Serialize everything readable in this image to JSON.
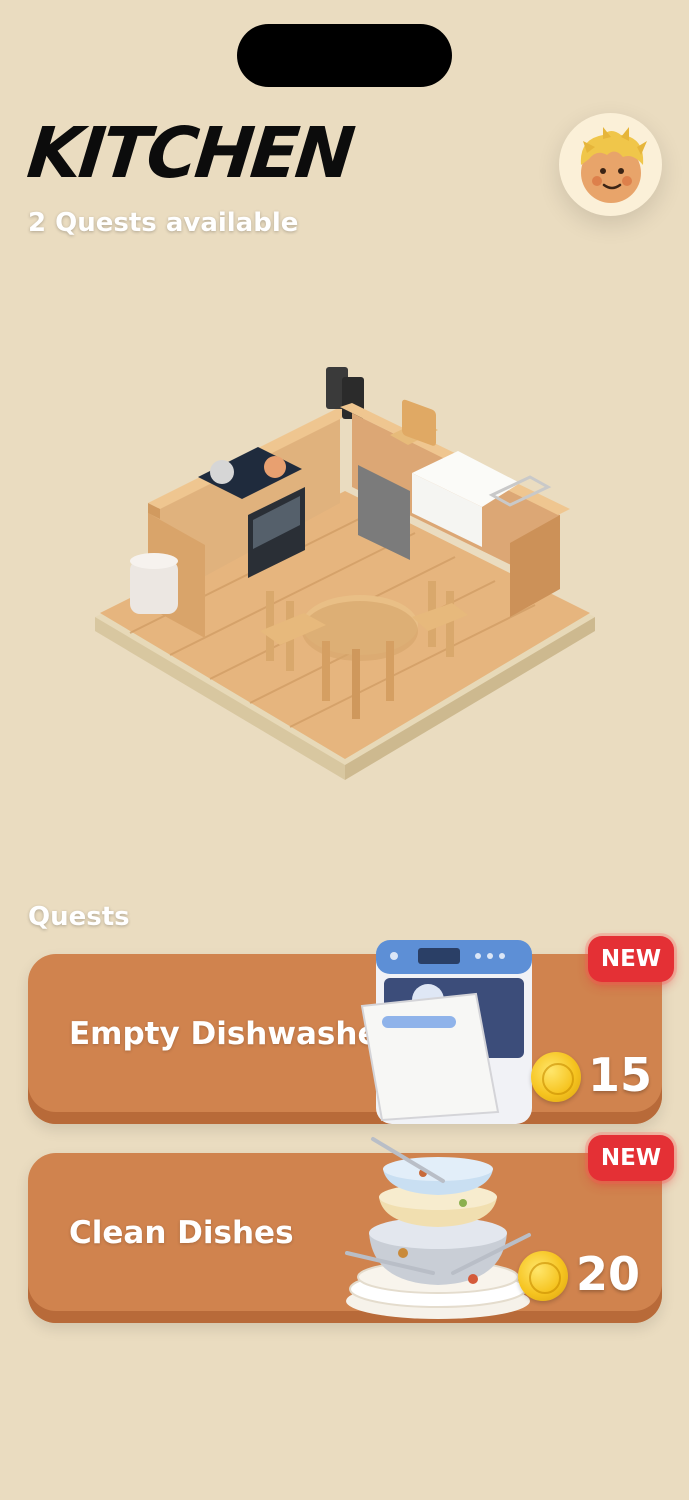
{
  "header": {
    "title": "KITCHEN",
    "subtitle": "2 Quests available"
  },
  "quests_section": {
    "label": "Quests",
    "items": [
      {
        "title": "Empty Dishwasher",
        "reward": "15",
        "badge": "NEW",
        "icon": "dishwasher-icon"
      },
      {
        "title": "Clean Dishes",
        "reward": "20",
        "badge": "NEW",
        "icon": "dirty-dishes-icon"
      }
    ]
  },
  "colors": {
    "background": "#eadcc0",
    "card": "#d0834e",
    "badge": "#e43035",
    "coin": "#f6c420"
  }
}
